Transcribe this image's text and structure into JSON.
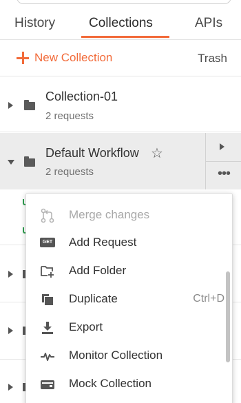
{
  "tabs": [
    {
      "label": "History"
    },
    {
      "label": "Collections",
      "active": true
    },
    {
      "label": "APIs"
    }
  ],
  "toolbar": {
    "new_collection_label": "New Collection",
    "trash_label": "Trash"
  },
  "collections": [
    {
      "name": "Collection-01",
      "count": "2 requests",
      "expanded": false
    },
    {
      "name": "Default Workflow",
      "count": "2 requests",
      "expanded": true
    }
  ],
  "context_menu": {
    "items": [
      {
        "label": "Merge changes",
        "icon": "merge-icon",
        "disabled": true
      },
      {
        "label": "Add Request",
        "icon": "get-request-icon"
      },
      {
        "label": "Add Folder",
        "icon": "add-folder-icon"
      },
      {
        "label": "Duplicate",
        "icon": "duplicate-icon",
        "shortcut": "Ctrl+D"
      },
      {
        "label": "Export",
        "icon": "export-icon"
      },
      {
        "label": "Monitor Collection",
        "icon": "monitor-icon"
      },
      {
        "label": "Mock Collection",
        "icon": "mock-icon"
      }
    ],
    "get_badge": "GET"
  },
  "colors": {
    "accent": "#f26b3a",
    "selected_row": "#ececec",
    "text": "#333333",
    "muted": "#707070",
    "disabled": "#a8a8a8",
    "success": "#2e9e4f"
  }
}
